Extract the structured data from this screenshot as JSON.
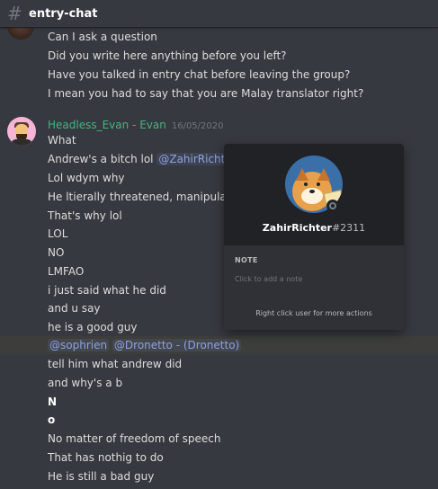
{
  "channel": {
    "icon": "hash-icon",
    "name": "entry-chat"
  },
  "prev_messages": [
    "Can I ask a question",
    "Did you write here anything before you left?",
    "Have you talked in entry chat before leaving the group?",
    "I mean you had to say that you are Malay translator right?"
  ],
  "group": {
    "author": "Headless_Evan - Evan",
    "timestamp": "16/05/2020",
    "author_color": "#43b581"
  },
  "messages": {
    "m1": "What",
    "m2_text": "Andrew's a bitch lol ",
    "m2_mention": "@ZahirRichter",
    "m3": "Lol wdym why",
    "m4": "He ltierally threatened, manipulated,",
    "m5": "That's why lol",
    "m6": "LOL",
    "m7": "NO",
    "m8": "LMFAO",
    "m9": "i just said what he did",
    "m10": "and u say",
    "m11": "he is a good guy",
    "m12_mention1": "@sophrien",
    "m12_mention2": "@Dronetto - (Dronetto)",
    "m13": "tell him what andrew did",
    "m14": "and why's a b",
    "m15": "N",
    "m16": "o",
    "m17": "No matter of freedom of speech",
    "m18": "That has nothig to do",
    "m19": "He is still a bad guy"
  },
  "popout": {
    "username": "ZahirRichter",
    "discriminator": "#2311",
    "note_label": "NOTE",
    "note_placeholder": "Click to add a note",
    "hint": "Right click user for more actions"
  }
}
